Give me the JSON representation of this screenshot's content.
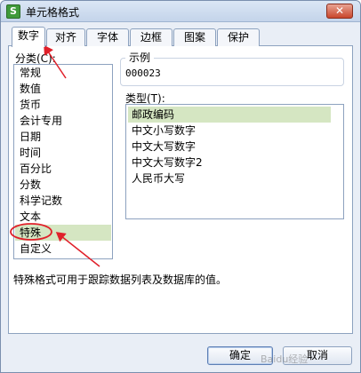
{
  "window": {
    "title": "单元格格式",
    "icon_letter": "S",
    "close_glyph": "✕"
  },
  "tabs": [
    {
      "label": "数字",
      "active": true
    },
    {
      "label": "对齐"
    },
    {
      "label": "字体"
    },
    {
      "label": "边框"
    },
    {
      "label": "图案"
    },
    {
      "label": "保护"
    }
  ],
  "category": {
    "label": "分类(C):",
    "items": [
      "常规",
      "数值",
      "货币",
      "会计专用",
      "日期",
      "时间",
      "百分比",
      "分数",
      "科学记数",
      "文本",
      "特殊",
      "自定义"
    ],
    "selected": "特殊"
  },
  "sample": {
    "title": "示例",
    "value": "000023"
  },
  "type": {
    "label": "类型(T):",
    "items": [
      "邮政编码",
      "中文小写数字",
      "中文大写数字",
      "中文大写数字2",
      "人民币大写"
    ],
    "selected": "邮政编码"
  },
  "description": "特殊格式可用于跟踪数据列表及数据库的值。",
  "buttons": {
    "ok": "确定",
    "cancel": "取消"
  },
  "annotation_color": "#e0202a",
  "watermark": "Baidu经验"
}
